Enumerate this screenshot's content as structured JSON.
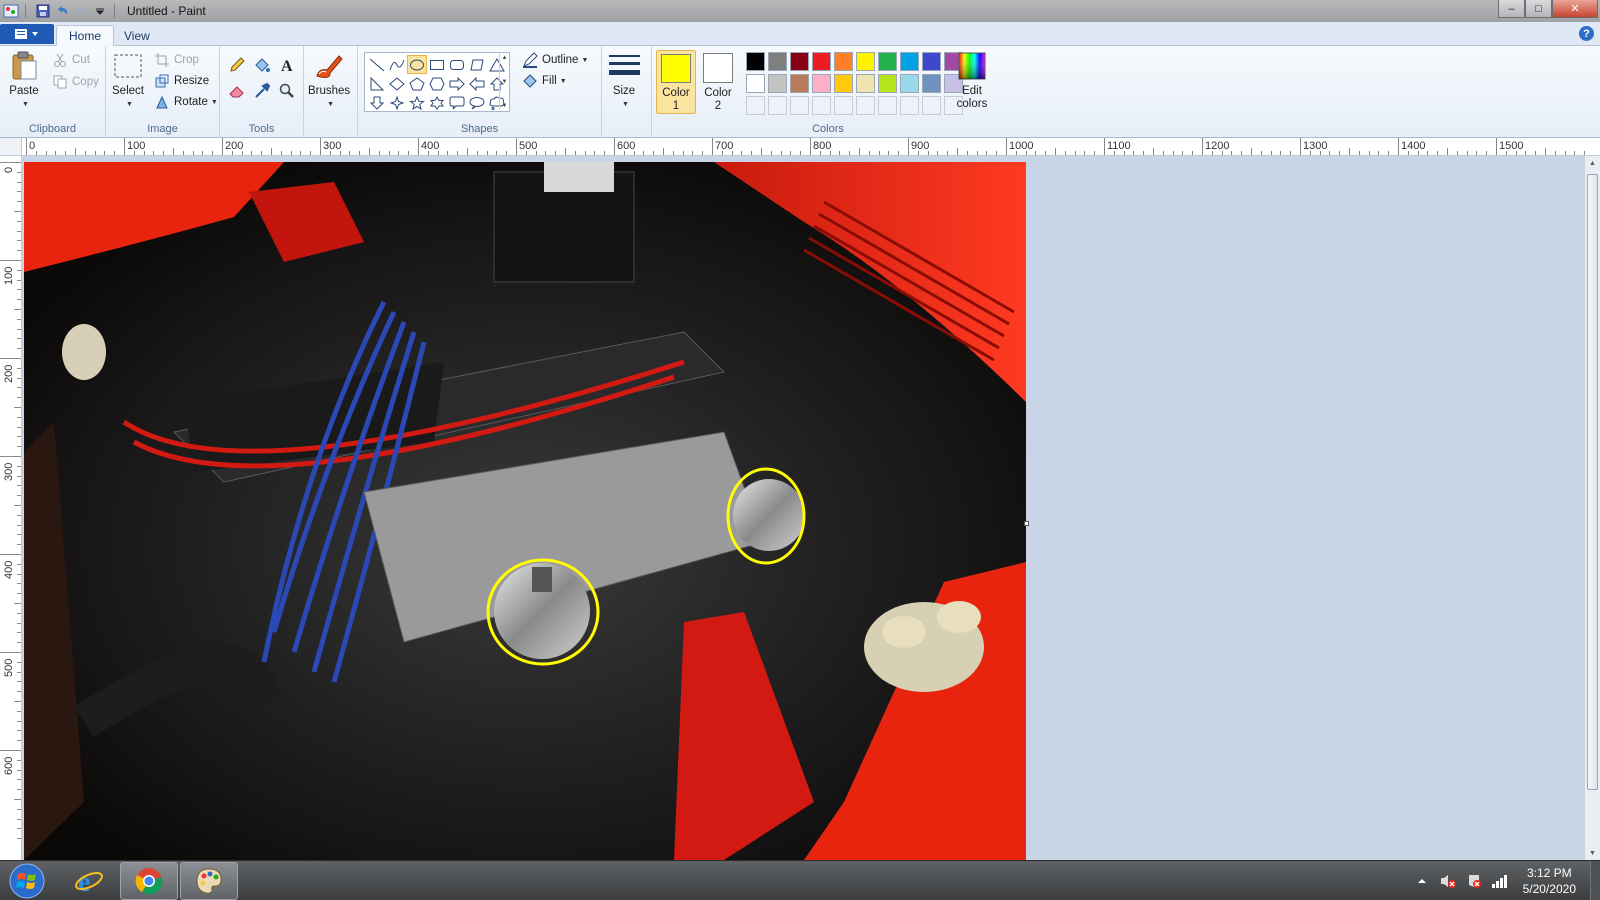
{
  "window": {
    "title": "Untitled - Paint",
    "controls": {
      "minimize": "–",
      "maximize": "□",
      "close": "✕"
    }
  },
  "ribbon": {
    "tabs": [
      {
        "label": "Home",
        "active": true
      },
      {
        "label": "View",
        "active": false
      }
    ],
    "help_label": "?",
    "clipboard": {
      "label": "Clipboard",
      "paste": "Paste",
      "cut": "Cut",
      "copy": "Copy"
    },
    "image": {
      "label": "Image",
      "select": "Select",
      "crop": "Crop",
      "resize": "Resize",
      "rotate": "Rotate"
    },
    "tools": {
      "label": "Tools"
    },
    "brushes": {
      "label": "Brushes"
    },
    "shapes": {
      "label": "Shapes",
      "outline": "Outline",
      "fill": "Fill"
    },
    "size": {
      "label": "Size"
    },
    "colors": {
      "label": "Colors",
      "color1": {
        "label_line1": "Color",
        "label_line2": "1",
        "value": "#ffff00"
      },
      "color2": {
        "label_line1": "Color",
        "label_line2": "2",
        "value": "#ffffff"
      },
      "edit": {
        "label_line1": "Edit",
        "label_line2": "colors"
      },
      "palette_row1": [
        "#000000",
        "#7f7f7f",
        "#880015",
        "#ed1c24",
        "#ff7f27",
        "#fff200",
        "#22b14c",
        "#00a2e8",
        "#3f48cc",
        "#a349a4"
      ],
      "palette_row2": [
        "#ffffff",
        "#c3c3c3",
        "#b97a57",
        "#ffaec9",
        "#ffc90e",
        "#efe4b0",
        "#b5e61d",
        "#99d9ea",
        "#7092be",
        "#c8bfe7"
      ]
    }
  },
  "rulers": {
    "horizontal": [
      "0",
      "100",
      "200",
      "300",
      "400",
      "500",
      "600",
      "700",
      "800",
      "900",
      "1000",
      "1100",
      "1200",
      "1300",
      "1400",
      "1500"
    ],
    "vertical": [
      "0",
      "100",
      "200",
      "300",
      "400",
      "500",
      "600"
    ]
  },
  "canvas": {
    "photo_subject": "engine-bay-photo",
    "annotation_color": "#ffff00"
  },
  "taskbar": {
    "clock_time": "3:12 PM",
    "clock_date": "5/20/2020"
  }
}
